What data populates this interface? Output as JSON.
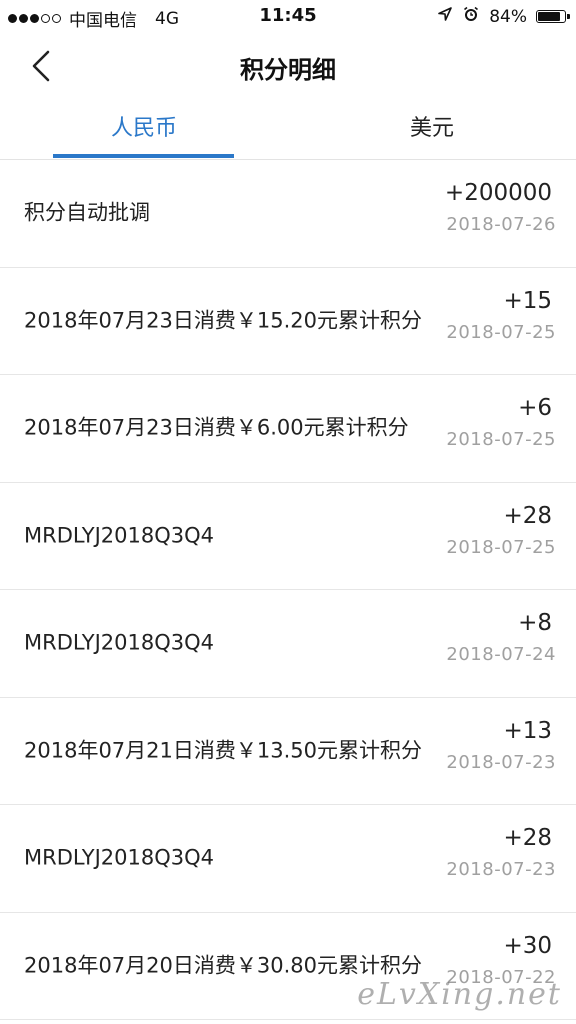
{
  "status_bar": {
    "carrier": "中国电信",
    "network": "4G",
    "time": "11:45",
    "battery_percent": "84%",
    "battery_level": 0.84,
    "signal_strength": 3,
    "signal_max": 5
  },
  "nav": {
    "title": "积分明细",
    "back_icon": "chevron-left-icon"
  },
  "tabs": [
    {
      "label": "人民币",
      "active": true
    },
    {
      "label": "美元",
      "active": false
    }
  ],
  "colors": {
    "accent": "#2b78c9",
    "date_gray": "#a0a0a0",
    "divider": "#e6e6e6"
  },
  "records": [
    {
      "description": "积分自动批调",
      "amount": "+200000",
      "date": "2018-07-26"
    },
    {
      "description": "2018年07月23日消费￥15.20元累计积分",
      "amount": "+15",
      "date": "2018-07-25"
    },
    {
      "description": "2018年07月23日消费￥6.00元累计积分",
      "amount": "+6",
      "date": "2018-07-25"
    },
    {
      "description": "MRDLYJ2018Q3Q4",
      "amount": "+28",
      "date": "2018-07-25"
    },
    {
      "description": "MRDLYJ2018Q3Q4",
      "amount": "+8",
      "date": "2018-07-24"
    },
    {
      "description": "2018年07月21日消费￥13.50元累计积分",
      "amount": "+13",
      "date": "2018-07-23"
    },
    {
      "description": "MRDLYJ2018Q3Q4",
      "amount": "+28",
      "date": "2018-07-23"
    },
    {
      "description": "2018年07月20日消费￥30.80元累计积分",
      "amount": "+30",
      "date": "2018-07-22"
    }
  ],
  "watermark": "eLvXing.net"
}
